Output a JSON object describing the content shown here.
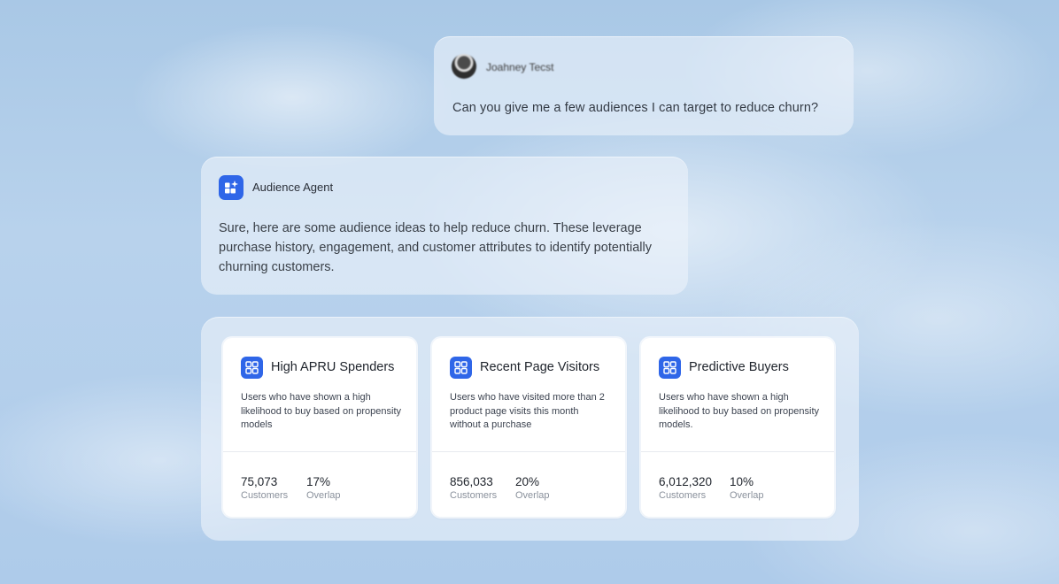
{
  "user": {
    "name": "Joahney Tecst",
    "message": "Can you give me a few audiences I can target to reduce churn?"
  },
  "agent": {
    "name": "Audience Agent",
    "message": "Sure, here are some audience ideas to help reduce churn. These leverage purchase history, engagement, and customer attributes to identify potentially churning customers."
  },
  "audiences": [
    {
      "title": "High APRU Spenders",
      "description": "Users who have shown a high likelihood to buy based on propensity models",
      "customers_value": "75,073",
      "customers_label": "Customers",
      "overlap_value": "17%",
      "overlap_label": "Overlap"
    },
    {
      "title": "Recent Page Visitors",
      "description": "Users who have visited more than 2 product page visits this month without a purchase",
      "customers_value": "856,033",
      "customers_label": "Customers",
      "overlap_value": "20%",
      "overlap_label": "Overlap"
    },
    {
      "title": "Predictive Buyers",
      "description": "Users who have shown a high likelihood to buy based on propensity models.",
      "customers_value": "6,012,320",
      "customers_label": "Customers",
      "overlap_value": "10%",
      "overlap_label": "Overlap"
    }
  ],
  "colors": {
    "accent": "#2f66e8",
    "sky": "#aecbea"
  },
  "icons": {
    "agent": "sparkle-grid-icon",
    "audience": "segment-grid-icon"
  }
}
